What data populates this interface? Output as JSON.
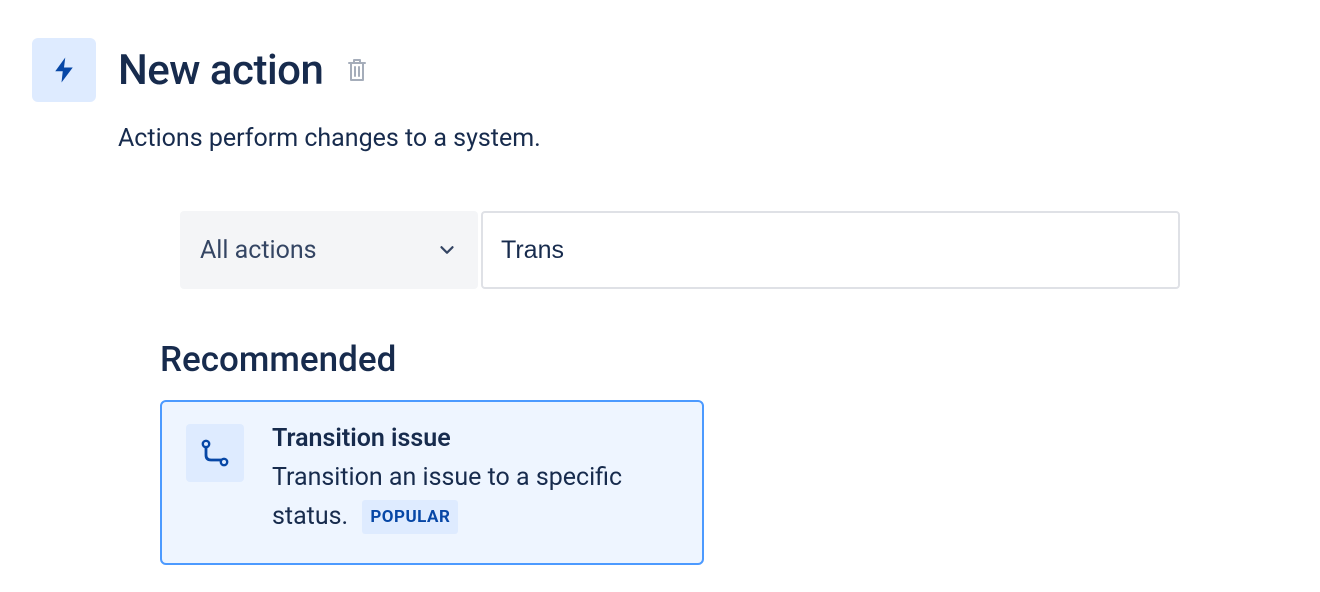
{
  "header": {
    "title": "New action",
    "subtitle": "Actions perform changes to a system."
  },
  "filter": {
    "select_label": "All actions",
    "search_value": "Trans"
  },
  "recommended": {
    "heading": "Recommended",
    "card": {
      "title": "Transition issue",
      "description": "Transition an issue to a specific status.",
      "badge": "POPULAR"
    }
  }
}
